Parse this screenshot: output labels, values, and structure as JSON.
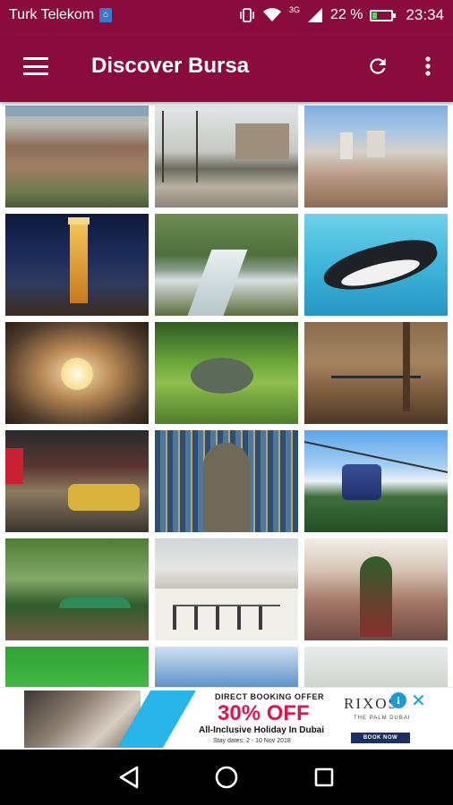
{
  "status_bar": {
    "carrier": "Turk Telekom",
    "network": "3G",
    "battery_text": "22 %",
    "battery_level": 0.22,
    "time": "23:34"
  },
  "app_bar": {
    "title": "Discover Bursa",
    "menu_icon": "hamburger-menu-icon",
    "refresh_icon": "refresh-icon",
    "more_icon": "more-vertical-icon",
    "color": "#8a0c3d"
  },
  "gallery": {
    "tiles": [
      {
        "label": "city-aerial-view"
      },
      {
        "label": "castle-street"
      },
      {
        "label": "city-panorama"
      },
      {
        "label": "clock-tower-night"
      },
      {
        "label": "river-park"
      },
      {
        "label": "penguin-aquarium"
      },
      {
        "label": "ornate-hall-chandelier"
      },
      {
        "label": "forest-stream"
      },
      {
        "label": "forest-cafe"
      },
      {
        "label": "automobile-museum"
      },
      {
        "label": "tiled-mihrab"
      },
      {
        "label": "cable-car"
      },
      {
        "label": "park-umbrellas"
      },
      {
        "label": "historic-mosque"
      },
      {
        "label": "shopping-mall"
      },
      {
        "label": "green-canopy"
      },
      {
        "label": "blue-tiles"
      },
      {
        "label": "tree-sky"
      }
    ]
  },
  "ad": {
    "offer_line": "DIRECT BOOKING OFFER",
    "discount": "30% OFF",
    "headline": "All-Inclusive Holiday In Dubai",
    "dates": "Stay dates: 2 - 10 Nov 2018",
    "brand": "RIXOS",
    "brand_sub": "THE PALM DUBAI",
    "cta": "BOOK NOW",
    "info_glyph": "i",
    "close_glyph": "✕"
  },
  "nav_bar": {
    "back_icon": "back-triangle-icon",
    "home_icon": "home-circle-icon",
    "recents_icon": "recents-square-icon"
  }
}
